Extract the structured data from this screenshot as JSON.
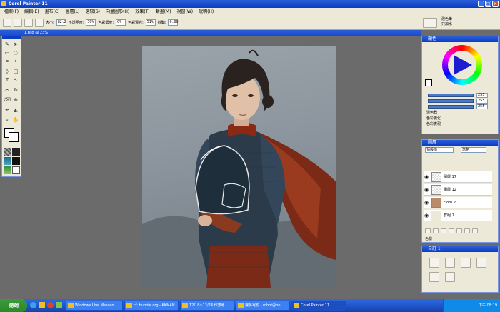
{
  "window": {
    "title": "Corel Painter 11"
  },
  "menu": [
    "檔案(F)",
    "編輯(E)",
    "畫布(C)",
    "圖層(L)",
    "選取(S)",
    "向量圖形(H)",
    "效果(T)",
    "動畫(M)",
    "視窗(W)",
    "說明(H)"
  ],
  "property_bar": {
    "size_label": "大小:",
    "size_value": "82.2",
    "opacity_label": "不透明度:",
    "opacity_value": "30%",
    "color_density_label": "色彩濃度:",
    "color_density_value": "0%",
    "blend_label": "色彩混合:",
    "blend_value": "51%",
    "jitter_label": "抖動:",
    "jitter_value": "0.00"
  },
  "brush_selector": {
    "category": "混色筆",
    "variant": "只加水"
  },
  "document": {
    "tab_title": "1.psd @ 23%"
  },
  "color_panel": {
    "title": "顏色",
    "rgb_values": [
      "255",
      "255",
      "255"
    ],
    "sections": [
      "混色器",
      "色彩變化",
      "色彩表現"
    ]
  },
  "layers_panel": {
    "title": "圖層",
    "blend_mode": "預設值",
    "composite": "忽略",
    "layers": [
      "圖層 17",
      "圖層 12",
      "cloth 2",
      "群組 1"
    ],
    "footer": "色樣"
  },
  "custom_panel": {
    "title": "自訂 1"
  },
  "taskbar": {
    "start_label": "開始",
    "tasks": [
      "Windows Live Messen...",
      "cf: bubble.org - KKMAN",
      "12/18~12/24 作業專...",
      "課多電影 - robot@bo...",
      "Corel Painter 11"
    ],
    "clock": "下午 08:19"
  },
  "colors": {
    "accent": "#0a3cc4",
    "panel_bg": "#ece9d8",
    "taskbar": "#245edb"
  },
  "icons": [
    "pen-icon",
    "eraser-icon",
    "selection-icon",
    "lasso-icon",
    "crop-icon",
    "text-icon",
    "hand-icon",
    "magnify-icon",
    "dropper-icon",
    "bucket-icon",
    "eye-icon",
    "color-wheel-icon"
  ]
}
